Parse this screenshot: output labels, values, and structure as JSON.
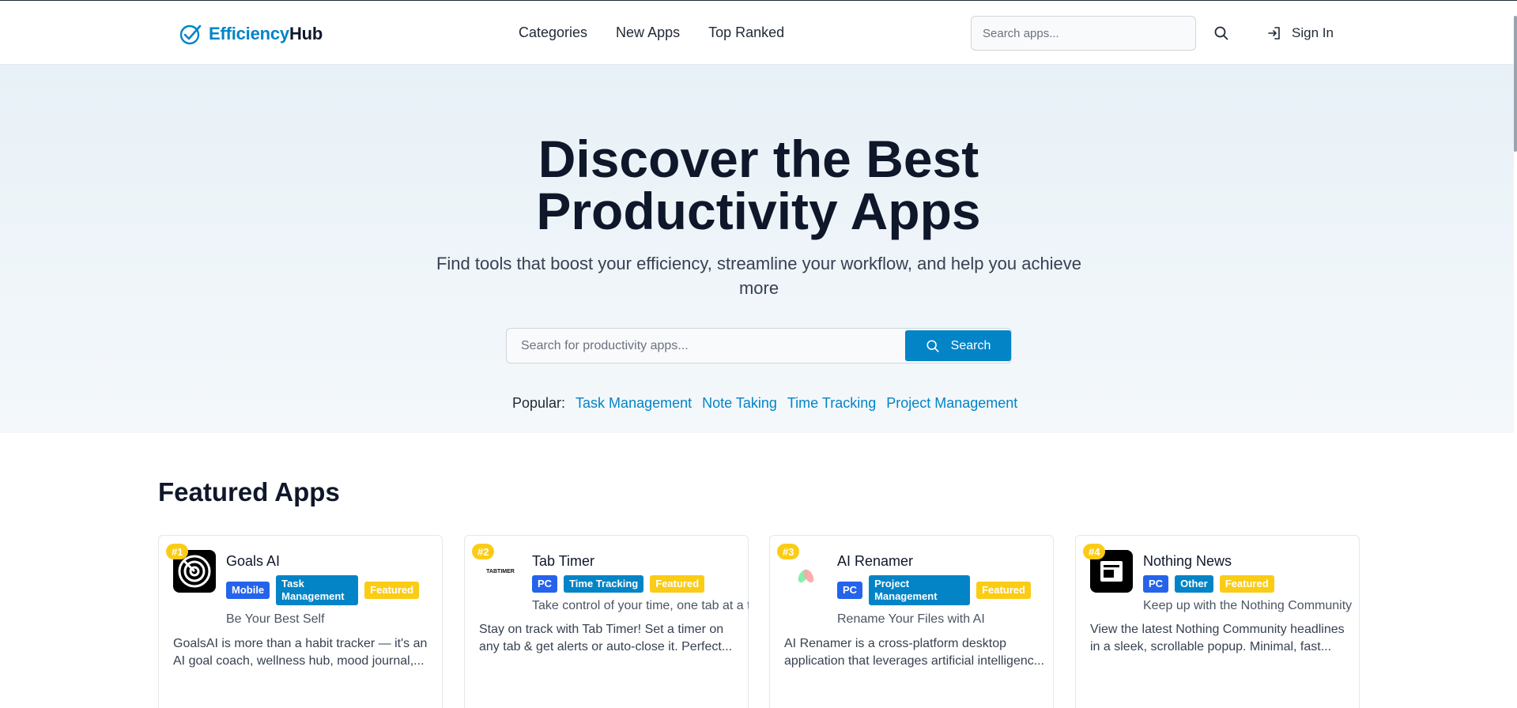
{
  "header": {
    "logo_part1": "Efficiency",
    "logo_part2": "Hub",
    "nav": [
      "Categories",
      "New Apps",
      "Top Ranked"
    ],
    "search_placeholder": "Search apps...",
    "sign_in": "Sign In"
  },
  "hero": {
    "title_line1": "Discover the Best",
    "title_line2": "Productivity Apps",
    "subtitle": "Find tools that boost your efficiency, streamline your workflow, and help you achieve more",
    "search_placeholder": "Search for productivity apps...",
    "search_button": "Search",
    "popular_label": "Popular:",
    "popular": [
      "Task Management",
      "Note Taking",
      "Time Tracking",
      "Project Management"
    ]
  },
  "featured": {
    "title": "Featured Apps",
    "apps": [
      {
        "rank": "#1",
        "name": "Goals AI",
        "tags": [
          "Mobile",
          "Task Management",
          "Featured"
        ],
        "tagline": "Be Your Best Self",
        "description": "GoalsAI is more than a habit tracker — it's an AI goal coach, wellness hub, mood journal,..."
      },
      {
        "rank": "#2",
        "name": "Tab Timer",
        "logo_text": "TABTIMER",
        "tags": [
          "PC",
          "Time Tracking",
          "Featured"
        ],
        "tagline": "Take control of your time, one tab at a ti",
        "description": "Stay on track with Tab Timer! Set a timer on any tab & get alerts or auto-close it. Perfect..."
      },
      {
        "rank": "#3",
        "name": "AI Renamer",
        "tags": [
          "PC",
          "Project Management",
          "Featured"
        ],
        "tagline": "Rename Your Files with AI",
        "description": "AI Renamer is a cross-platform desktop application that leverages artificial intelligenc..."
      },
      {
        "rank": "#4",
        "name": "Nothing News",
        "tags": [
          "PC",
          "Other",
          "Featured"
        ],
        "tagline": "Keep up with the Nothing Community",
        "description": "View the latest Nothing Community headlines in a sleek, scrollable popup. Minimal, fast..."
      }
    ]
  },
  "colors": {
    "accent": "#0284c7",
    "tag_blue": "#2563eb",
    "featured_yellow": "#facc15",
    "dark_text": "#0f172a"
  },
  "icons": [
    "check-circle-icon",
    "search-icon",
    "sign-in-icon"
  ]
}
